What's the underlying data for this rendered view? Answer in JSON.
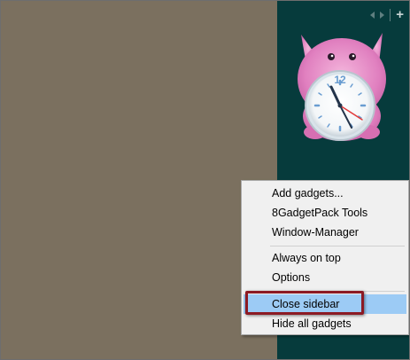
{
  "sidebar": {
    "nav": {
      "prev_icon": "triangle-left",
      "next_icon": "triangle-right",
      "add_label": "+"
    },
    "clock_gadget": {
      "hour_marker": "12",
      "character": "pink-furry-monster"
    }
  },
  "context_menu": {
    "items": [
      {
        "label": "Add gadgets..."
      },
      {
        "label": "8GadgetPack Tools"
      },
      {
        "label": "Window-Manager"
      },
      {
        "label": "Always on top"
      },
      {
        "label": "Options"
      },
      {
        "label": "Close sidebar",
        "highlighted": true
      },
      {
        "label": "Hide all gadgets"
      }
    ]
  },
  "colors": {
    "desktop": "#7b705f",
    "sidebar": "#063b3c",
    "highlight": "#9ccbf5",
    "callout": "#8c1a24"
  }
}
